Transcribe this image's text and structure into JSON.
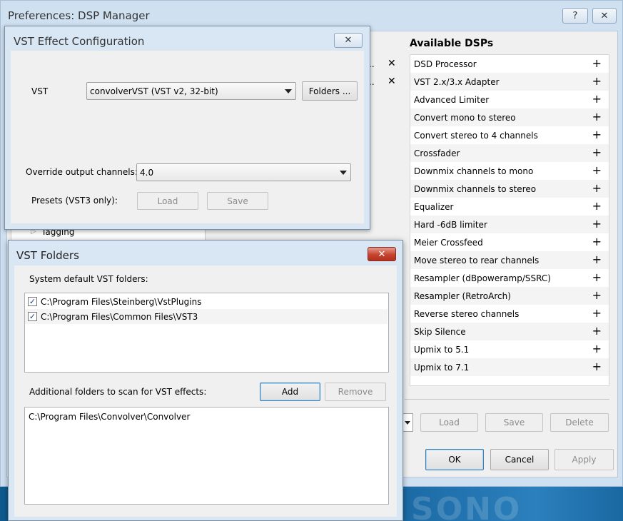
{
  "preferences": {
    "title": "Preferences: DSP Manager",
    "help_label": "?",
    "close_label": "✕",
    "available_heading": "Available DSPs",
    "available_dsps": [
      "DSD Processor",
      "VST 2.x/3.x Adapter",
      "Advanced Limiter",
      "Convert mono to stereo",
      "Convert stereo to 4 channels",
      "Crossfader",
      "Downmix channels to mono",
      "Downmix channels to stereo",
      "Equalizer",
      "Hard -6dB limiter",
      "Meier Crossfeed",
      "Move stereo to rear channels",
      "Resampler (dBpoweramp/SSRC)",
      "Resampler (RetroArch)",
      "Reverse stereo channels",
      "Skip Silence",
      "Upmix to 5.1",
      "Upmix to 7.1"
    ],
    "add_symbol": "+",
    "remove_symbol": "✕",
    "active_fragment": "..",
    "preset_buttons": {
      "load": "Load",
      "save": "Save",
      "delete": "Delete"
    },
    "dialog_buttons": {
      "ok": "OK",
      "cancel": "Cancel",
      "apply": "Apply"
    },
    "tree_fragment": "Tagging"
  },
  "vst_config": {
    "title": "VST Effect Configuration",
    "close_label": "✕",
    "vst_label": "VST",
    "vst_selected": "convolverVST (VST v2, 32-bit)",
    "folders_button": "Folders ...",
    "override_label": "Override output channels:",
    "override_selected": "4.0",
    "presets_label": "Presets (VST3 only):",
    "load_label": "Load",
    "save_label": "Save"
  },
  "vst_folders": {
    "title": "VST Folders",
    "close_label": "✕",
    "system_label": "System default VST folders:",
    "system_folders": [
      {
        "path": "C:\\Program Files\\Steinberg\\VstPlugins",
        "checked": true
      },
      {
        "path": "C:\\Program Files\\Common Files\\VST3",
        "checked": true
      }
    ],
    "additional_label": "Additional folders to scan for VST effects:",
    "add_label": "Add",
    "remove_label": "Remove",
    "additional_folders": [
      "C:\\Program Files\\Convolver\\Convolver"
    ]
  },
  "background": {
    "logo_text": "SONO"
  },
  "icons": {
    "check": "✓",
    "dropdown": "dropdown-arrow-icon",
    "expand": "triangle-right-icon"
  }
}
